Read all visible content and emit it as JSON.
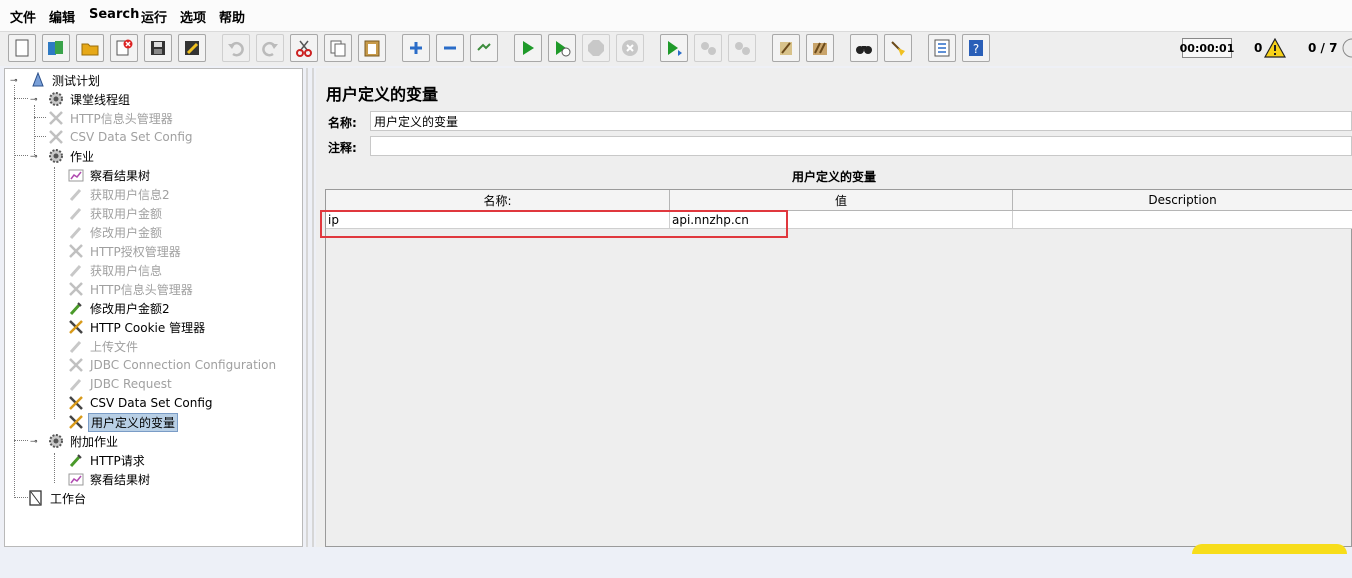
{
  "menu": [
    "文件",
    "编辑",
    "Search",
    "运行",
    "选项",
    "帮助"
  ],
  "toolbar": {
    "timer": "00:00:01",
    "warnings": "0",
    "threads": "0 / 7",
    "buttons": [
      "new",
      "templates",
      "open",
      "close",
      "save",
      "save-as-edit",
      "undo",
      "redo",
      "cut",
      "copy",
      "paste",
      "expand",
      "collapse",
      "toggle",
      "start",
      "start-no-pause",
      "stop",
      "shutdown",
      "remote-start",
      "remote-stop",
      "remote-exit",
      "clear",
      "clear-all",
      "search",
      "reset-search",
      "function-helper",
      "help"
    ]
  },
  "tree": [
    {
      "label": "测试计划",
      "icon": "test-plan-icon",
      "enabled": true
    },
    {
      "label": "课堂线程组",
      "icon": "thread-group-icon",
      "enabled": true
    },
    {
      "label": "HTTP信息头管理器",
      "icon": "config-element-icon",
      "enabled": false
    },
    {
      "label": "CSV Data Set Config",
      "icon": "config-element-icon",
      "enabled": false
    },
    {
      "label": "作业",
      "icon": "thread-group-icon",
      "enabled": true
    },
    {
      "label": "察看结果树",
      "icon": "listener-icon",
      "enabled": true
    },
    {
      "label": "获取用户信息2",
      "icon": "sampler-icon",
      "enabled": false
    },
    {
      "label": "获取用户金额",
      "icon": "sampler-icon",
      "enabled": false
    },
    {
      "label": "修改用户金额",
      "icon": "sampler-icon",
      "enabled": false
    },
    {
      "label": "HTTP授权管理器",
      "icon": "config-element-icon",
      "enabled": false
    },
    {
      "label": "获取用户信息",
      "icon": "sampler-icon",
      "enabled": false
    },
    {
      "label": "HTTP信息头管理器",
      "icon": "config-element-icon",
      "enabled": false
    },
    {
      "label": "修改用户金额2",
      "icon": "sampler-icon",
      "enabled": true
    },
    {
      "label": "HTTP Cookie 管理器",
      "icon": "config-element-icon",
      "enabled": true
    },
    {
      "label": "上传文件",
      "icon": "sampler-icon",
      "enabled": false
    },
    {
      "label": "JDBC Connection Configuration",
      "icon": "config-element-icon",
      "enabled": false
    },
    {
      "label": "JDBC Request",
      "icon": "sampler-icon",
      "enabled": false
    },
    {
      "label": "CSV Data Set Config",
      "icon": "config-element-icon",
      "enabled": true
    },
    {
      "label": "用户定义的变量",
      "icon": "config-element-icon",
      "enabled": true,
      "selected": true
    },
    {
      "label": "附加作业",
      "icon": "thread-group-icon",
      "enabled": true
    },
    {
      "label": "HTTP请求",
      "icon": "sampler-icon",
      "enabled": true
    },
    {
      "label": "察看结果树",
      "icon": "listener-icon",
      "enabled": true
    },
    {
      "label": "工作台",
      "icon": "workbench-icon",
      "enabled": true
    }
  ],
  "panel": {
    "title": "用户定义的变量",
    "name_label": "名称:",
    "name_value": "用户定义的变量",
    "comment_label": "注释:",
    "comment_value": "",
    "table_title": "用户定义的变量",
    "columns": [
      "名称:",
      "值",
      "Description"
    ],
    "rows": [
      {
        "name": "ip",
        "value": "api.nnzhp.cn",
        "description": ""
      }
    ]
  },
  "colors": {
    "highlight": "#e0383e",
    "selection": "#b8cfe5"
  }
}
